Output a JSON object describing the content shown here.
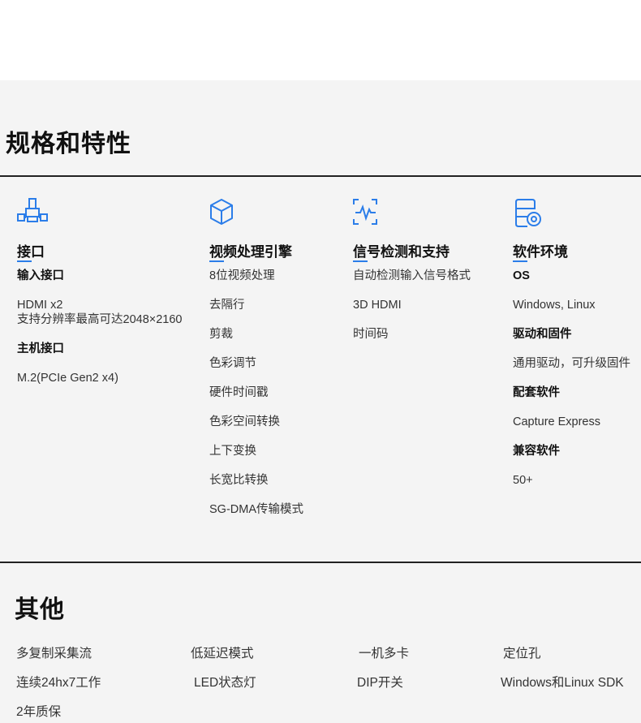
{
  "specs": {
    "title": "规格和特性",
    "columns": [
      {
        "icon": "network-port-icon",
        "title": "接口",
        "items": [
          {
            "text": "输入接口",
            "bold": true
          },
          {
            "text": "HDMI x2",
            "bold": false
          },
          {
            "text": "支持分辨率最高可达2048×2160",
            "bold": false
          },
          {
            "text": "主机接口",
            "bold": true
          },
          {
            "text": "M.2(PCIe Gen2 x4)",
            "bold": false
          }
        ]
      },
      {
        "icon": "cube-icon",
        "title": "视频处理引擎",
        "items": [
          {
            "text": "8位视频处理",
            "bold": false
          },
          {
            "text": "去隔行",
            "bold": false
          },
          {
            "text": "剪裁",
            "bold": false
          },
          {
            "text": "色彩调节",
            "bold": false
          },
          {
            "text": "硬件时间戳",
            "bold": false
          },
          {
            "text": "色彩空间转换",
            "bold": false
          },
          {
            "text": "上下变换",
            "bold": false
          },
          {
            "text": "长宽比转换",
            "bold": false
          },
          {
            "text": "SG-DMA传输模式",
            "bold": false
          }
        ]
      },
      {
        "icon": "signal-scan-icon",
        "title": "信号检测和支持",
        "items": [
          {
            "text": "自动检测输入信号格式",
            "bold": false
          },
          {
            "text": "3D HDMI",
            "bold": false
          },
          {
            "text": "时间码",
            "bold": false
          }
        ]
      },
      {
        "icon": "disk-drive-icon",
        "title": "软件环境",
        "items": [
          {
            "text": "OS",
            "bold": true
          },
          {
            "text": "Windows, Linux",
            "bold": false
          },
          {
            "text": "驱动和固件",
            "bold": true
          },
          {
            "text": "通用驱动，可升级固件",
            "bold": false
          },
          {
            "text": "配套软件",
            "bold": true
          },
          {
            "text": "Capture Express",
            "bold": false
          },
          {
            "text": "兼容软件",
            "bold": true
          },
          {
            "text": "50+",
            "bold": false
          }
        ]
      }
    ]
  },
  "other": {
    "title": "其他",
    "items": [
      "多复制采集流",
      "低延迟模式",
      "一机多卡",
      "定位孔",
      "连续24hx7工作",
      "LED状态灯",
      "DIP开关",
      "Windows和Linux SDK",
      "2年质保"
    ]
  },
  "colors": {
    "accent": "#2b7de9",
    "panel_bg": "#f4f4f4",
    "rule": "#222222"
  }
}
